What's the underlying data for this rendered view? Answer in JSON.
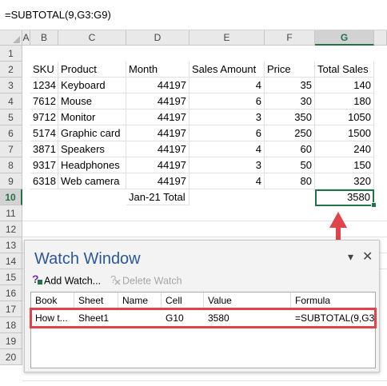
{
  "formula_bar": {
    "formula": "=SUBTOTAL(9,G3:G9)"
  },
  "columns": [
    "A",
    "B",
    "C",
    "D",
    "E",
    "F",
    "G"
  ],
  "rows": [
    "1",
    "2",
    "3",
    "4",
    "5",
    "6",
    "7",
    "8",
    "9",
    "10",
    "11",
    "12",
    "13",
    "14",
    "15",
    "16",
    "17",
    "18",
    "19",
    "20"
  ],
  "headers": {
    "sku": "SKU",
    "product": "Product",
    "month": "Month",
    "sales_amount": "Sales Amount",
    "price": "Price",
    "total_sales": "Total Sales"
  },
  "data_rows": [
    {
      "sku": "1234",
      "product": "Keyboard",
      "month": "44197",
      "sales_amount": "4",
      "price": "35",
      "total": "140"
    },
    {
      "sku": "7612",
      "product": "Mouse",
      "month": "44197",
      "sales_amount": "6",
      "price": "30",
      "total": "180"
    },
    {
      "sku": "9712",
      "product": "Monitor",
      "month": "44197",
      "sales_amount": "3",
      "price": "350",
      "total": "1050"
    },
    {
      "sku": "5174",
      "product": "Graphic card",
      "month": "44197",
      "sales_amount": "6",
      "price": "250",
      "total": "1500"
    },
    {
      "sku": "3871",
      "product": "Speakers",
      "month": "44197",
      "sales_amount": "4",
      "price": "60",
      "total": "240"
    },
    {
      "sku": "9317",
      "product": "Headphones",
      "month": "44197",
      "sales_amount": "3",
      "price": "50",
      "total": "150"
    },
    {
      "sku": "6318",
      "product": "Web camera",
      "month": "44197",
      "sales_amount": "4",
      "price": "80",
      "total": "320"
    }
  ],
  "total_row": {
    "label": "Jan-21 Total",
    "value": "3580"
  },
  "watch_window": {
    "title": "Watch Window",
    "add_watch": "Add Watch...",
    "delete_watch": "Delete Watch",
    "columns": [
      "Book",
      "Sheet",
      "Name",
      "Cell",
      "Value",
      "Formula"
    ],
    "row": {
      "book": "How t...",
      "sheet": "Sheet1",
      "name": "",
      "cell": "G10",
      "value": "3580",
      "formula": "=SUBTOTAL(9,G3..."
    }
  },
  "colors": {
    "excel_green": "#217346",
    "highlight_red": "#e2434b",
    "title_blue": "#2b579a"
  },
  "icons": [
    "dropdown-icon",
    "close-icon",
    "add-watch-icon",
    "delete-watch-icon",
    "up-arrow-icon"
  ]
}
